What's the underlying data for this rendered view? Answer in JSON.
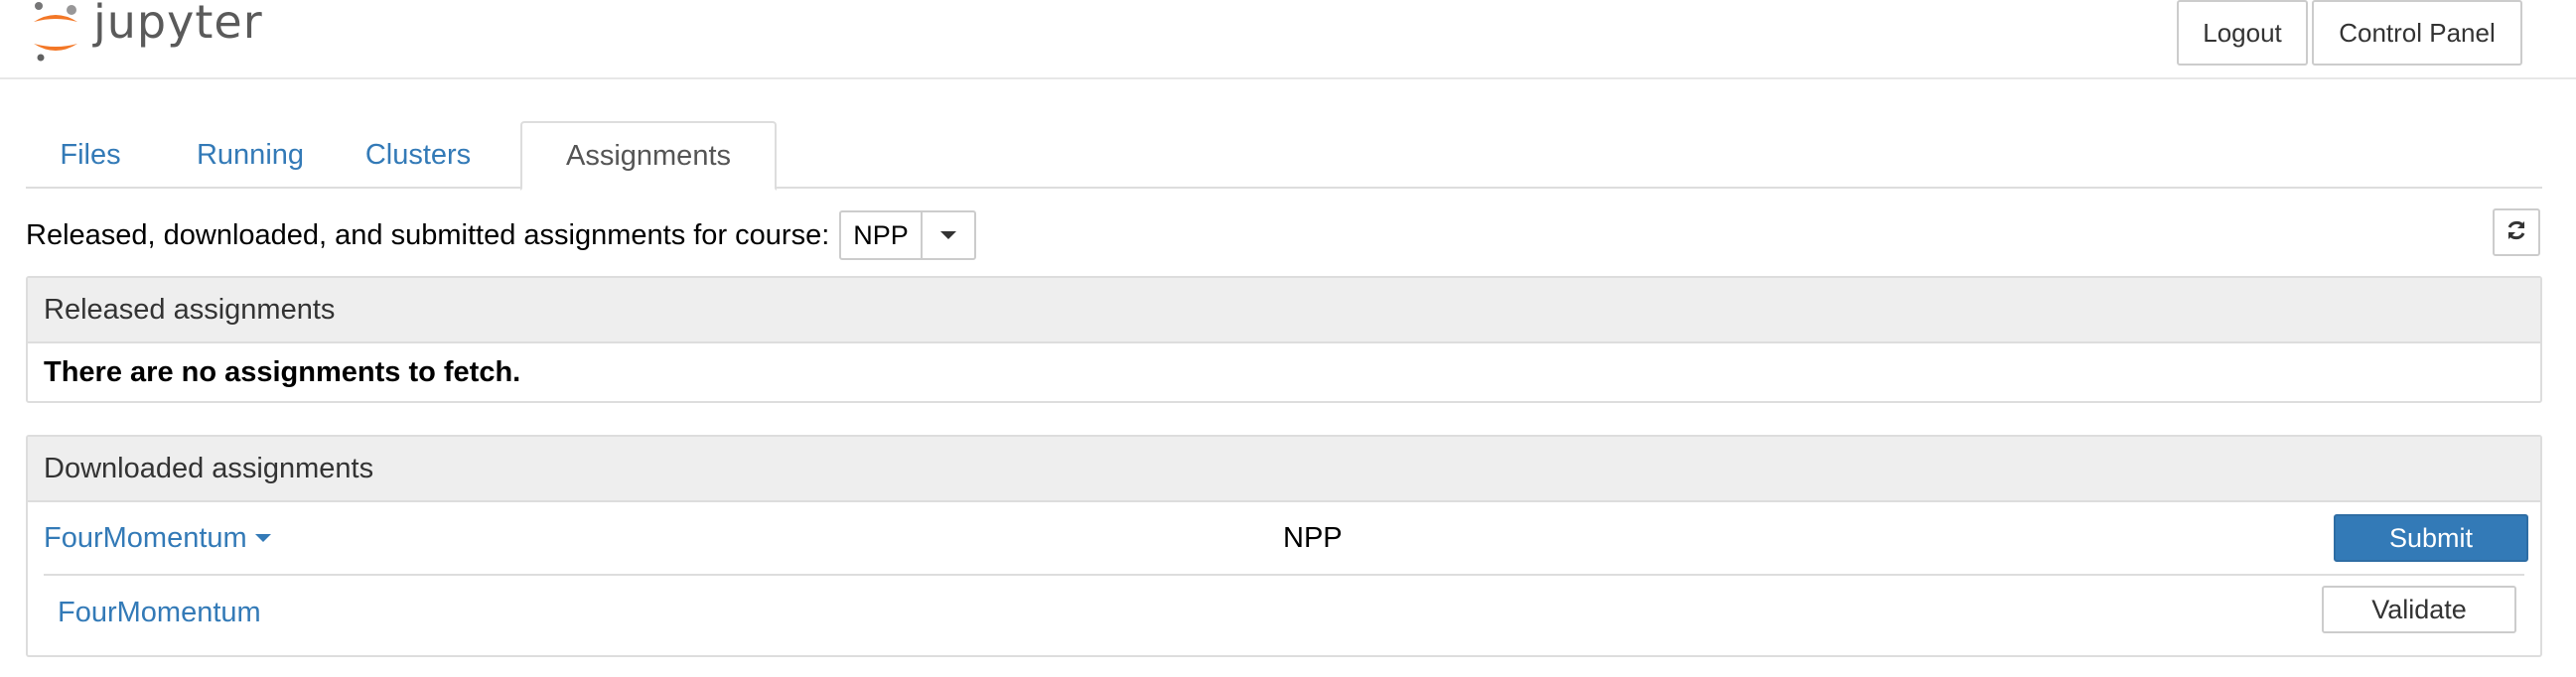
{
  "header": {
    "logo_text": "jupyter",
    "logout_label": "Logout",
    "control_panel_label": "Control Panel"
  },
  "tabs": [
    {
      "label": "Files"
    },
    {
      "label": "Running"
    },
    {
      "label": "Clusters"
    },
    {
      "label": "Assignments",
      "active": true
    }
  ],
  "course_selector": {
    "label": "Released, downloaded, and submitted assignments for course:",
    "selected": "NPP"
  },
  "released": {
    "heading": "Released assignments",
    "empty_message": "There are no assignments to fetch."
  },
  "downloaded": {
    "heading": "Downloaded assignments",
    "assignment": {
      "name": "FourMomentum",
      "course": "NPP",
      "submit_label": "Submit"
    },
    "notebook": {
      "name": "FourMomentum",
      "validate_label": "Validate"
    }
  },
  "icons": {
    "logo": "jupyter-logo-icon",
    "refresh": "refresh-icon",
    "caret": "caret-down-icon"
  },
  "colors": {
    "link": "#337ab7",
    "primary_button": "#337ab7",
    "logo_orange": "#f37726",
    "panel_heading_bg": "#eeeeee"
  }
}
